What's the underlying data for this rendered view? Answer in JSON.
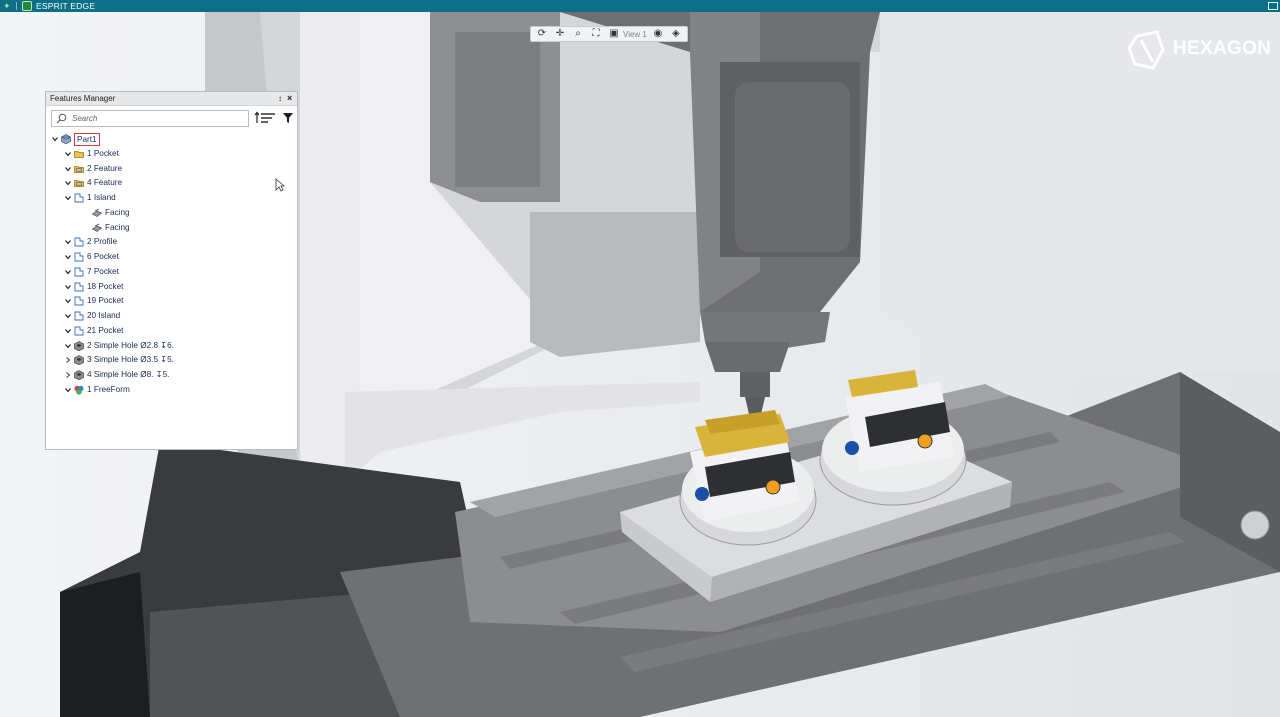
{
  "app": {
    "title": "ESPRIT EDGE",
    "brand": "HEXAGON"
  },
  "view_toolbar": {
    "view_label": "View 1",
    "icons": [
      "rotate-icon",
      "pan-icon",
      "zoom-icon",
      "fit-icon",
      "view-cube-icon",
      "visibility-icon",
      "render-mode-icon"
    ]
  },
  "features_manager": {
    "title": "Features Manager",
    "pin_glyph": "↕",
    "close_glyph": "×",
    "search_placeholder": "Search",
    "items": [
      {
        "label": "Part1",
        "expanded": "down",
        "icon": "part-icon"
      },
      {
        "label": "1 Pocket",
        "expanded": "down",
        "icon": "folder-icon"
      },
      {
        "label": "2 Feature",
        "expanded": "down",
        "icon": "feature-group-icon"
      },
      {
        "label": "4 Feature",
        "expanded": "down",
        "icon": "feature-group-icon"
      },
      {
        "label": "1 Island",
        "expanded": "down",
        "icon": "chain-feature-icon"
      },
      {
        "label": "Facing",
        "expanded": "none",
        "icon": "facing-operation-icon"
      },
      {
        "label": "Facing",
        "expanded": "none",
        "icon": "facing-operation-icon"
      },
      {
        "label": "2 Profile",
        "expanded": "down",
        "icon": "chain-feature-icon"
      },
      {
        "label": "6 Pocket",
        "expanded": "down",
        "icon": "chain-feature-icon"
      },
      {
        "label": "7 Pocket",
        "expanded": "down",
        "icon": "chain-feature-icon"
      },
      {
        "label": "18 Pocket",
        "expanded": "down",
        "icon": "chain-feature-icon"
      },
      {
        "label": "19 Pocket",
        "expanded": "down",
        "icon": "chain-feature-icon"
      },
      {
        "label": "20 Island",
        "expanded": "down",
        "icon": "chain-feature-icon"
      },
      {
        "label": "21 Pocket",
        "expanded": "down",
        "icon": "chain-feature-icon"
      },
      {
        "label": "2 Simple Hole Ø2.8 ↧6.",
        "expanded": "down",
        "icon": "hole-feature-icon"
      },
      {
        "label": "3 Simple Hole Ø3.5 ↧5.",
        "expanded": "right",
        "icon": "hole-feature-icon"
      },
      {
        "label": "4 Simple Hole Ø8. ↧5.",
        "expanded": "right",
        "icon": "hole-feature-icon"
      },
      {
        "label": "1 FreeForm",
        "expanded": "down",
        "icon": "freeform-icon"
      }
    ]
  },
  "colors": {
    "titlebar": "#0c6f87",
    "selection_border": "#d04040",
    "tree_text": "#1b2a55",
    "fixture_gold": "#d9b43a",
    "locator_blue": "#1b4fa8",
    "locator_orange": "#f0a020"
  }
}
